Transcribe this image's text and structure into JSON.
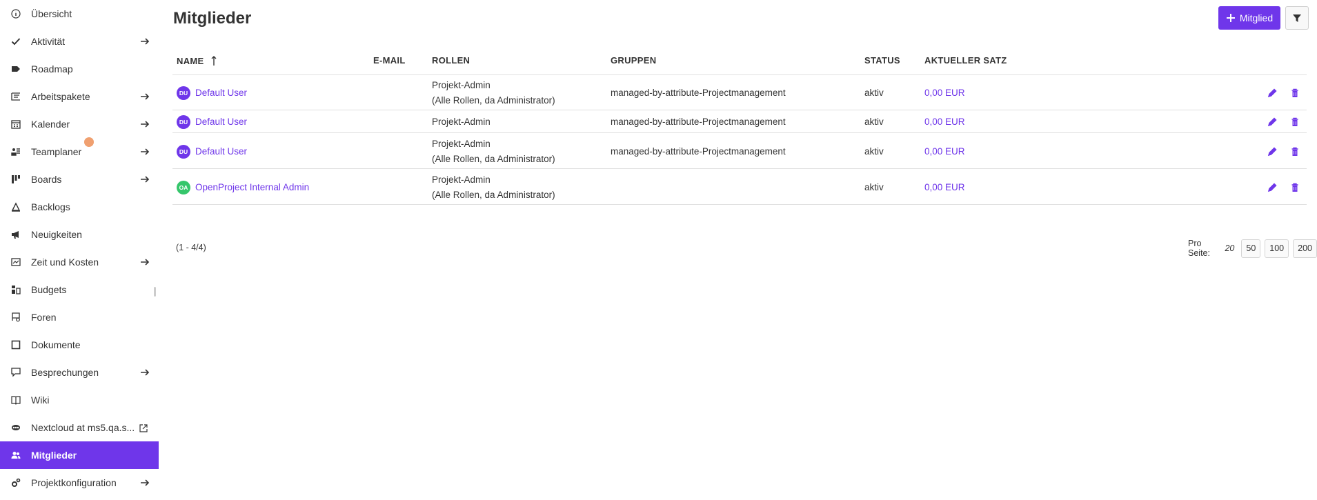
{
  "sidebar": {
    "items": [
      {
        "label": "Übersicht",
        "icon": "info-icon",
        "arrow": false
      },
      {
        "label": "Aktivität",
        "icon": "checkmark-icon",
        "arrow": true
      },
      {
        "label": "Roadmap",
        "icon": "tag-icon",
        "arrow": false
      },
      {
        "label": "Arbeitspakete",
        "icon": "work-packages-icon",
        "arrow": true
      },
      {
        "label": "Kalender",
        "icon": "calendar-icon",
        "arrow": true
      },
      {
        "label": "Teamplaner",
        "icon": "team-planner-icon",
        "arrow": true
      },
      {
        "label": "Boards",
        "icon": "boards-icon",
        "arrow": true
      },
      {
        "label": "Backlogs",
        "icon": "backlogs-icon",
        "arrow": false
      },
      {
        "label": "Neuigkeiten",
        "icon": "megaphone-icon",
        "arrow": false
      },
      {
        "label": "Zeit und Kosten",
        "icon": "time-costs-icon",
        "arrow": true
      },
      {
        "label": "Budgets",
        "icon": "budget-icon",
        "arrow": false
      },
      {
        "label": "Foren",
        "icon": "forum-icon",
        "arrow": false
      },
      {
        "label": "Dokumente",
        "icon": "document-icon",
        "arrow": false
      },
      {
        "label": "Besprechungen",
        "icon": "meetings-icon",
        "arrow": true
      },
      {
        "label": "Wiki",
        "icon": "wiki-book-icon",
        "arrow": false
      },
      {
        "label": "Nextcloud at ms5.qa.s...",
        "icon": "nextcloud-icon",
        "arrow": false
      },
      {
        "label": "Mitglieder",
        "icon": "members-icon",
        "arrow": false
      },
      {
        "label": "Projektkonfiguration",
        "icon": "settings-gears-icon",
        "arrow": true
      }
    ],
    "active_index": 16
  },
  "header": {
    "title": "Mitglieder",
    "add_label": "Mitglied"
  },
  "table": {
    "columns": [
      "NAME",
      "E-MAIL",
      "ROLLEN",
      "GRUPPEN",
      "STATUS",
      "AKTUELLER SATZ"
    ],
    "rows": [
      {
        "initials": "DU",
        "avatar_color": "#6f36ea",
        "name": "Default User",
        "email": "",
        "role1": "Projekt-Admin",
        "role2": "(Alle Rollen, da Administrator)",
        "group": "managed-by-attribute-Projectmanagement",
        "status": "aktiv",
        "rate": "0,00 EUR"
      },
      {
        "initials": "DU",
        "avatar_color": "#6f36ea",
        "name": "Default User",
        "email": "",
        "role1": "Projekt-Admin",
        "role2": "",
        "group": "managed-by-attribute-Projectmanagement",
        "status": "aktiv",
        "rate": "0,00 EUR"
      },
      {
        "initials": "DU",
        "avatar_color": "#6f36ea",
        "name": "Default User",
        "email": "",
        "role1": "Projekt-Admin",
        "role2": "(Alle Rollen, da Administrator)",
        "group": "managed-by-attribute-Projectmanagement",
        "status": "aktiv",
        "rate": "0,00 EUR"
      },
      {
        "initials": "OA",
        "avatar_color": "#35c66b",
        "name": "OpenProject Internal Admin",
        "email": "",
        "role1": "Projekt-Admin",
        "role2": "(Alle Rollen, da Administrator)",
        "group": "",
        "status": "aktiv",
        "rate": "0,00 EUR"
      }
    ],
    "footer_count": "(1 - 4/4)",
    "per_page_label": "Pro Seite:",
    "per_page_current": "20",
    "per_page_options": [
      "50",
      "100",
      "200"
    ]
  },
  "colors": {
    "accent": "#6f36ea",
    "avatar_oa": "#35c66b"
  }
}
